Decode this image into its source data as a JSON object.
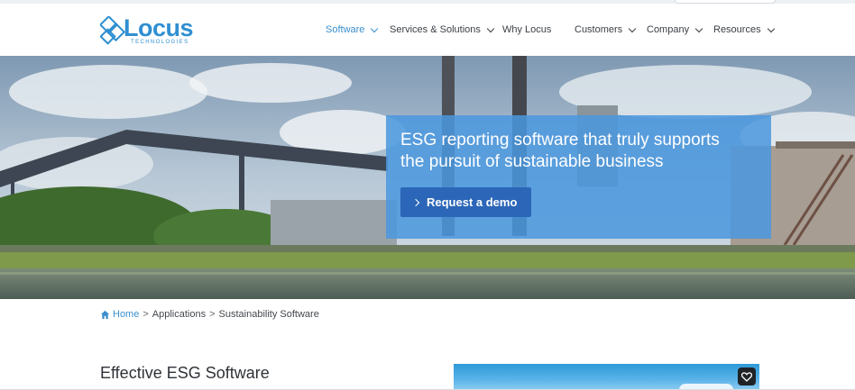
{
  "logo": {
    "name": "Locus",
    "sub": "TECHNOLOGIES"
  },
  "nav": [
    {
      "label": "Software",
      "has_menu": true,
      "active": true
    },
    {
      "label": "Services & Solutions",
      "has_menu": true,
      "active": false
    },
    {
      "label": "Why Locus",
      "has_menu": false,
      "active": false
    },
    {
      "label": "Customers",
      "has_menu": true,
      "active": false
    },
    {
      "label": "Company",
      "has_menu": true,
      "active": false
    },
    {
      "label": "Resources",
      "has_menu": true,
      "active": false
    }
  ],
  "hero": {
    "headline_line1": "ESG reporting software that truly supports",
    "headline_line2": "the pursuit of sustainable business",
    "cta_label": "Request a demo"
  },
  "breadcrumb": {
    "home": "Home",
    "items": [
      "Applications",
      "Sustainability Software"
    ],
    "separator": ">"
  },
  "section": {
    "title": "Effective ESG Software"
  },
  "colors": {
    "brand": "#2f8fd1",
    "accent_nav": "#3a8fcf",
    "cta_box": "#4a97de",
    "cta_button": "#2c66b8"
  },
  "icons": {
    "home": "home-icon",
    "favorite": "heart-icon"
  }
}
